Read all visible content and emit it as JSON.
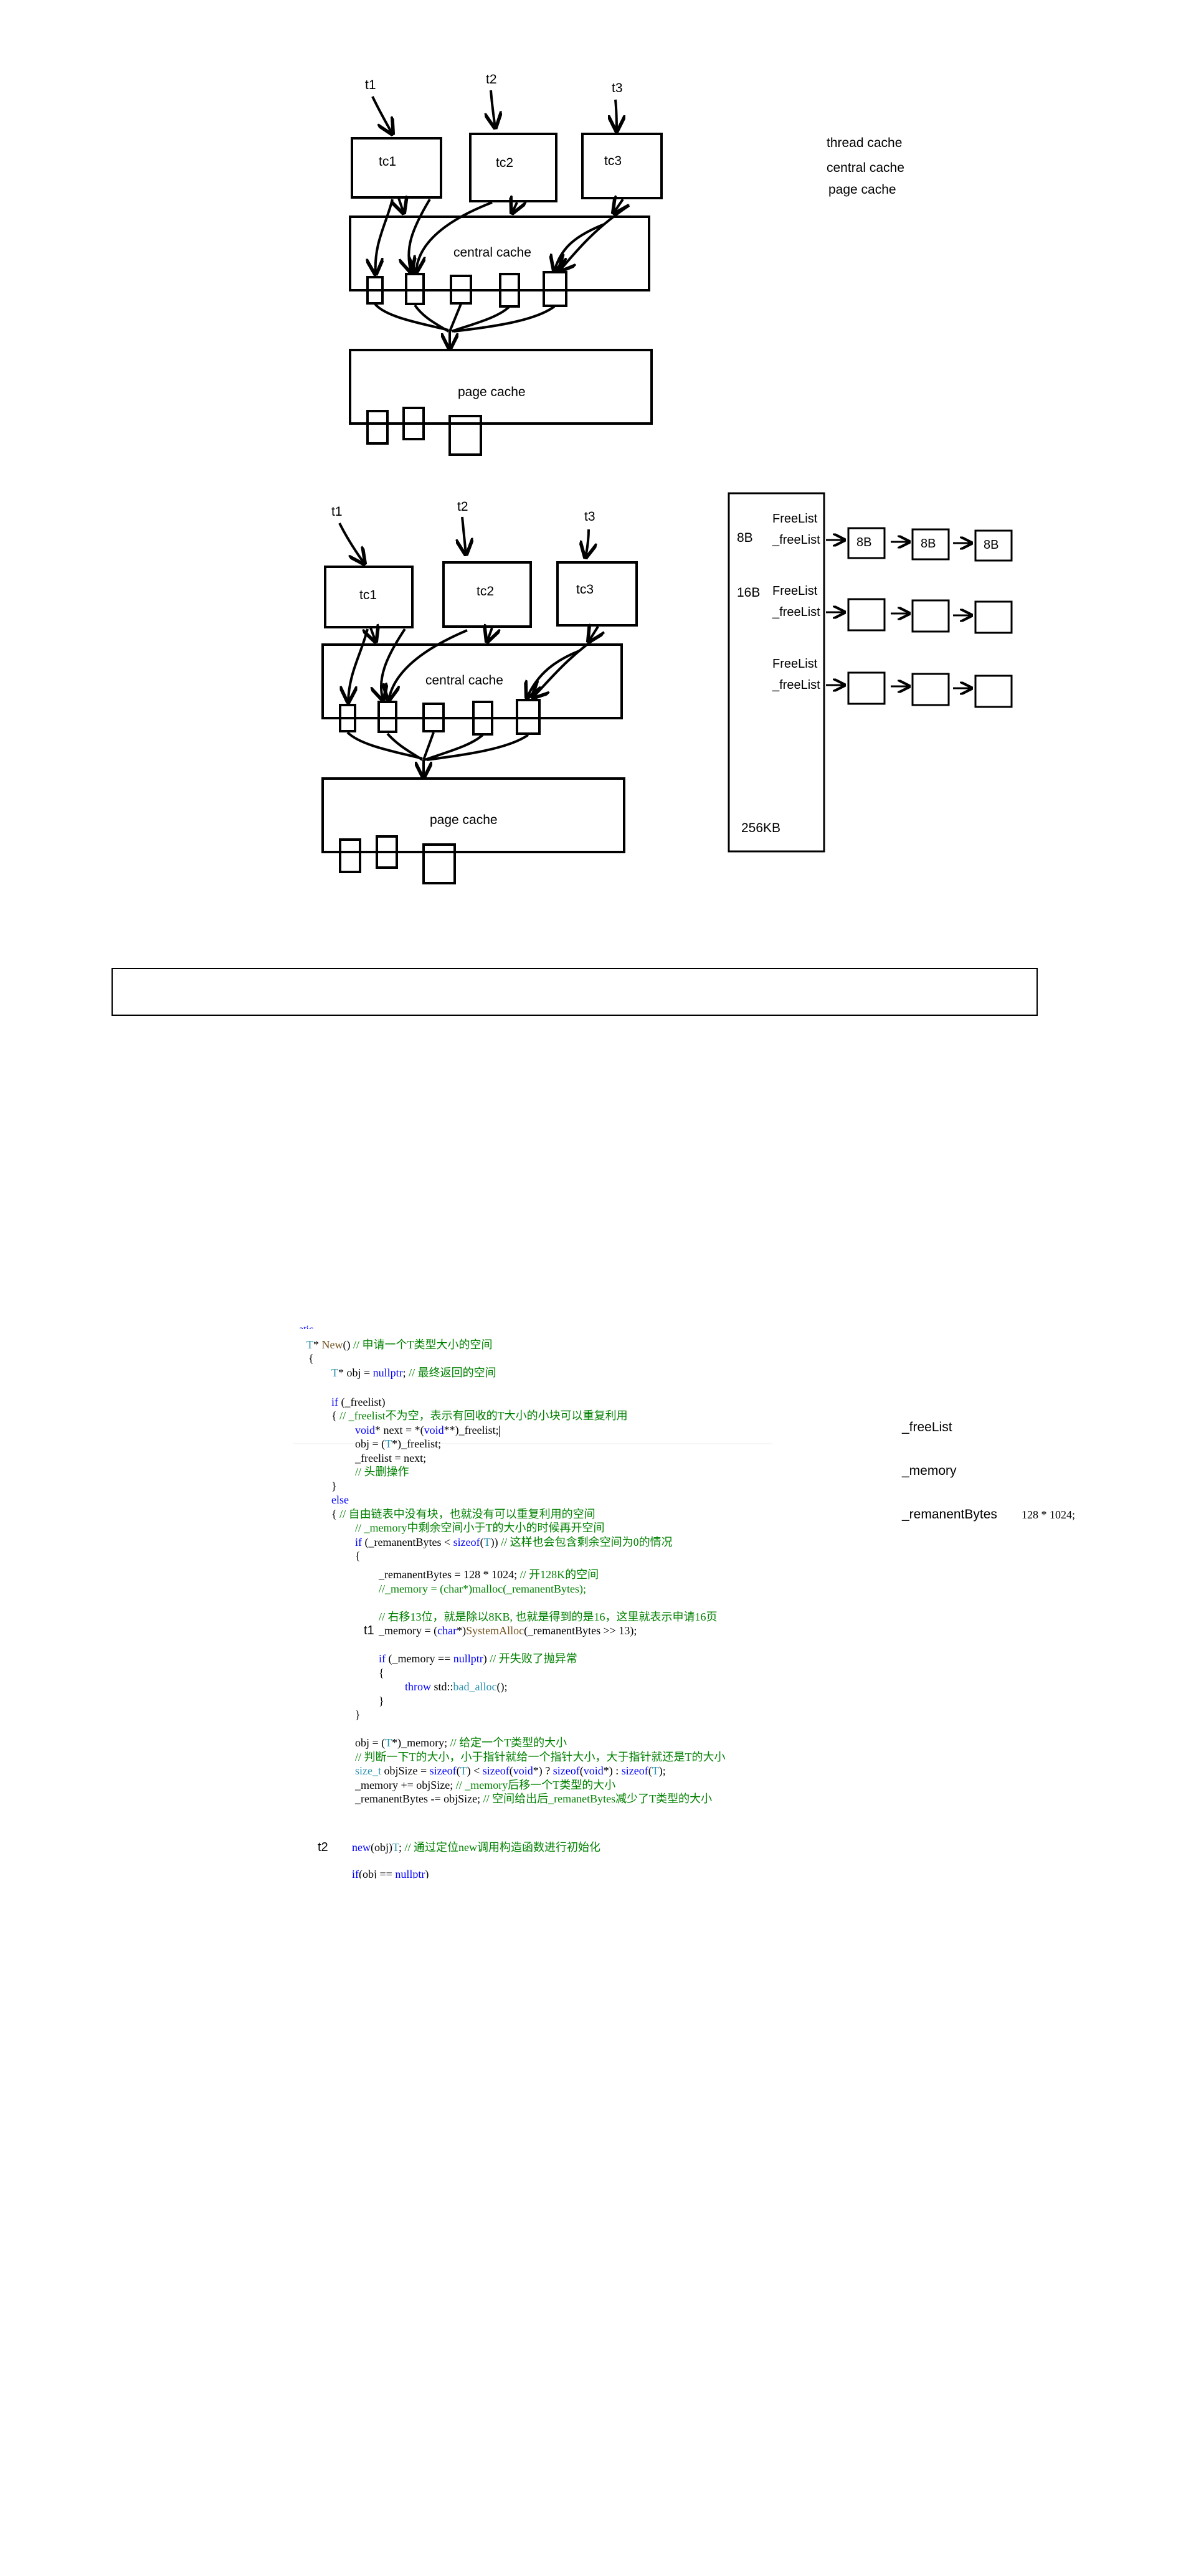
{
  "diagram1": {
    "threads": [
      "t1",
      "t2",
      "t3"
    ],
    "thread_caches": [
      "tc1",
      "tc2",
      "tc3"
    ],
    "central": "central cache",
    "page": "page cache",
    "legend": [
      "thread cache",
      "central cache",
      "page cache"
    ]
  },
  "diagram2": {
    "threads": [
      "t1",
      "t2",
      "t3"
    ],
    "thread_caches": [
      "tc1",
      "tc2",
      "tc3"
    ],
    "central": "central cache",
    "page": "page cache"
  },
  "freelist_panel": {
    "rows": [
      {
        "size": "8B",
        "label1": "FreeList",
        "label2": "_freeList",
        "blocks": [
          "8B",
          "8B",
          "8B"
        ]
      },
      {
        "size": "16B",
        "label1": "FreeList",
        "label2": "_freeList",
        "blocks": [
          "",
          "",
          ""
        ]
      },
      {
        "size": "",
        "label1": "FreeList",
        "label2": "_freeList",
        "blocks": [
          "",
          "",
          ""
        ]
      }
    ],
    "bottom": "256KB"
  },
  "code": {
    "lines": [
      "T* New() // 申请一个T类型大小的空间",
      "{",
      "T* obj = nullptr; // 最终返回的空间",
      "if (_freelist)",
      "{ // _freelist不为空，表示有回收的T大小的小块可以重复利用",
      "void* next = *(void**)_freelist;",
      "obj = (T*)_freelist;",
      "_freelist = next;",
      "// 头删操作",
      "}",
      "else",
      "{ // 自由链表中没有块，也就没有可以重复利用的空间",
      "// _memory中剩余空间小于T的大小的时候再开空间",
      "if (_remanentBytes < sizeof(T)) // 这样也会包含剩余空间为0的情况",
      "{",
      "_remanentBytes = 128 * 1024; // 开128K的空间",
      "//_memory = (char*)malloc(_remanentBytes);",
      "// 右移13位，就是除以8KB, 也就是得到的是16，这里就表示申请16页",
      "_memory = (char*)SystemAlloc(_remanentBytes >> 13);",
      "if (_memory == nullptr) // 开失败了抛异常",
      "{",
      "throw std::bad_alloc();",
      "}",
      "}",
      "obj = (T*)_memory; // 给定一个T类型的大小",
      "// 判断一下T的大小，小于指针就给一个指针大小，大于指针就还是T的大小",
      "size_t objSize = sizeof(T) < sizeof(void*) ? sizeof(void*) : sizeof(T);",
      "_memory += objSize; // _memory后移一个T类型的大小",
      "_remanentBytes -= objSize; // 空间给出后_remanetBytes减少了T类型的大小",
      "new(obj)T; // 通过定位new调用构造函数进行初始化",
      "if(obj == nullptr)"
    ],
    "markers": {
      "t1": "t1",
      "t2": "t2"
    },
    "side_vars": [
      "_freeList",
      "_memory",
      "_remanentBytes"
    ],
    "side_value": "128 * 1024;"
  }
}
